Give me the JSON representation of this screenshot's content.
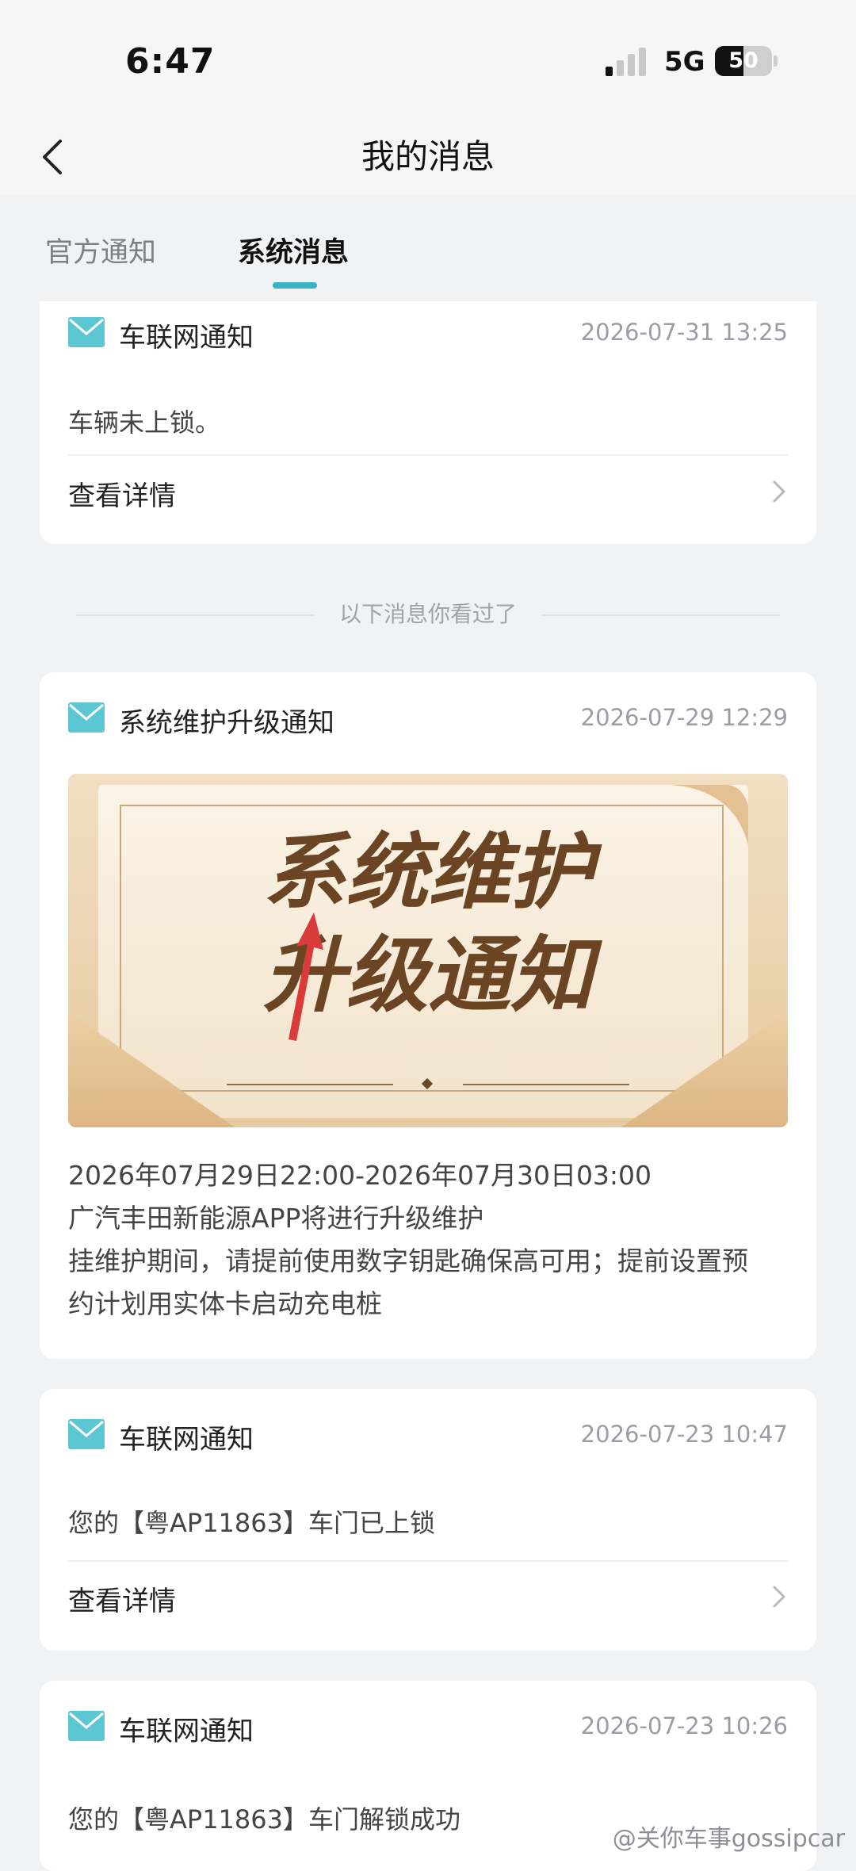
{
  "status_bar": {
    "time": "6:47",
    "network": "5G",
    "battery_level": "50",
    "battery_fraction": 0.5
  },
  "header": {
    "title": "我的消息"
  },
  "tabs": [
    {
      "label": "官方通知",
      "active": false
    },
    {
      "label": "系统消息",
      "active": true
    }
  ],
  "messages": [
    {
      "title": "车联网通知",
      "time": "2026-07-31 13:25",
      "body": "车辆未上锁。",
      "details_label": "查看详情"
    },
    {
      "title": "系统维护升级通知",
      "time": "2026-07-29 12:29",
      "banner_line1": "系统维护",
      "banner_line2": "升级通知",
      "notice_lines": [
        "2026年07月29日22:00-2026年07月30日03:00",
        "广汽丰田新能源APP将进行升级维护",
        "挂维护期间，请提前使用数字钥匙确保高可用；提前设置预",
        "约计划用实体卡启动充电桩"
      ]
    },
    {
      "title": "车联网通知",
      "time": "2026-07-23 10:47",
      "body": "您的【粤AP11863】车门已上锁",
      "details_label": "查看详情"
    },
    {
      "title": "车联网通知",
      "time": "2026-07-23 10:26",
      "body": "您的【粤AP11863】车门解锁成功"
    }
  ],
  "seen_divider": "以下消息你看过了",
  "watermark": "@关你车事gossipcar",
  "colors": {
    "accent": "#39b3c3",
    "mail_icon": "#5dc6d3",
    "background": "#f1f2f4"
  }
}
